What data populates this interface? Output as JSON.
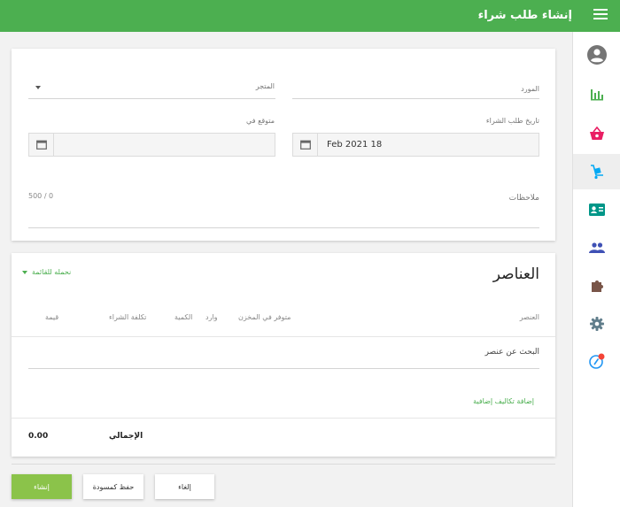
{
  "header": {
    "title": "إنشاء طلب شراء"
  },
  "sidebar": {
    "items": [
      {
        "name": "profile"
      },
      {
        "name": "reports"
      },
      {
        "name": "sales"
      },
      {
        "name": "purchases",
        "active": true
      },
      {
        "name": "contacts"
      },
      {
        "name": "users"
      },
      {
        "name": "plugins"
      },
      {
        "name": "settings"
      },
      {
        "name": "notifications",
        "badge": true
      }
    ]
  },
  "form": {
    "supplier_label": "المورد",
    "store_label": "المتجر",
    "order_date_label": "تاريخ طلب الشراء",
    "order_date_value": "Feb 2021 18",
    "expected_label": "متوقع في",
    "expected_value": "",
    "notes_label": "ملاحظات",
    "notes_counter": "500 / 0"
  },
  "items": {
    "title": "العناصر",
    "tax_select": "نحمله للقائمة",
    "columns": {
      "item": "العنصر",
      "in_stock": "متوفر في المخزن",
      "incoming": "وارد",
      "quantity": "الكمية",
      "purchase_cost": "تكلفة الشراء",
      "value": "قيمة"
    },
    "search_placeholder": "البحث عن عنصر",
    "add_costs": "إضافة تكاليف إضافية",
    "total_label": "الإجمالي",
    "total_value": "0.00"
  },
  "actions": {
    "create": "إنشاء",
    "save_draft": "حفظ كمسودة",
    "cancel": "إلغاء"
  },
  "colors": {
    "primary": "#4caf50",
    "button": "#8bc34a"
  }
}
